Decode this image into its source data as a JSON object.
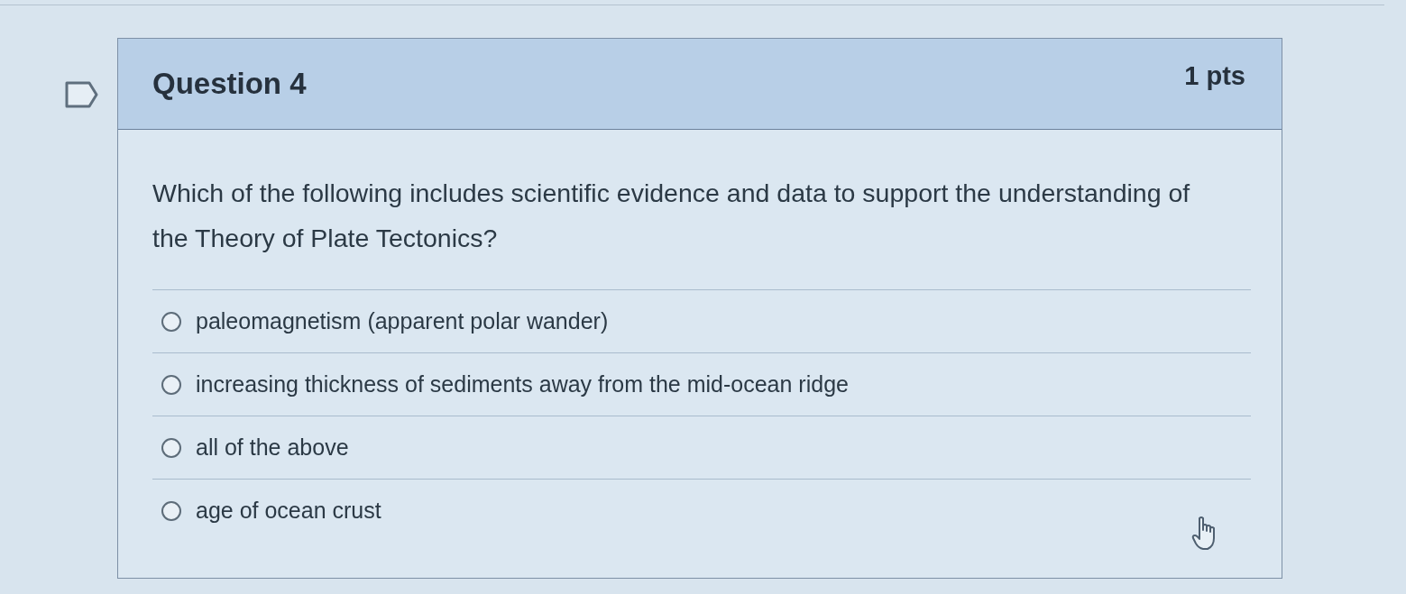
{
  "flag": {
    "flagged": false
  },
  "question": {
    "title": "Question 4",
    "points": "1 pts",
    "text": "Which of the following includes scientific evidence and data to support the understanding of the Theory of Plate Tectonics?",
    "answers": [
      {
        "label": "paleomagnetism (apparent polar wander)",
        "selected": false
      },
      {
        "label": "increasing thickness of sediments away from the mid-ocean ridge",
        "selected": false
      },
      {
        "label": "all of the above",
        "selected": false
      },
      {
        "label": "age of ocean crust",
        "selected": false
      }
    ]
  }
}
